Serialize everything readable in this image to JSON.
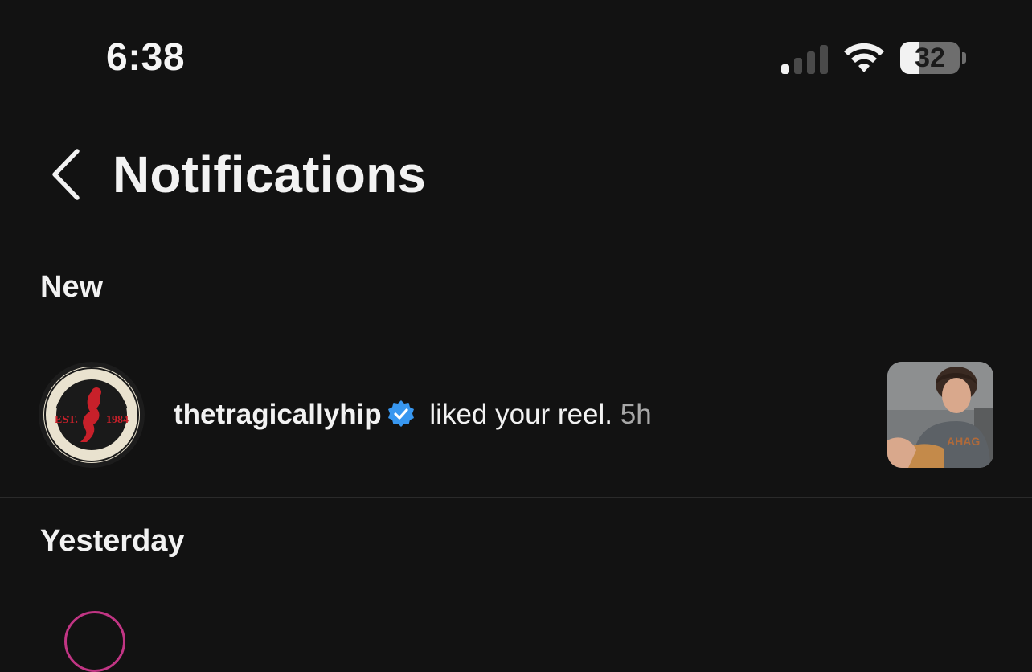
{
  "status_bar": {
    "time": "6:38",
    "battery_percent": "32",
    "battery_level": 0.32,
    "signal_bars_active": 1,
    "signal_bars_total": 4,
    "wifi_icon": "wifi-icon",
    "signal_icon": "cellular-signal-icon"
  },
  "header": {
    "back_icon": "chevron-left-icon",
    "title": "Notifications"
  },
  "sections": {
    "new_label": "New",
    "yesterday_label": "Yesterday"
  },
  "notifications": [
    {
      "username": "thetragicallyhip",
      "verified": true,
      "action": " liked your reel.",
      "time": "5h",
      "avatar_icon": "band-logo-avatar",
      "thumbnail": "reel-thumbnail"
    }
  ],
  "colors": {
    "background": "#121212",
    "text_primary": "#f2f2f2",
    "text_secondary": "#a8a8a8",
    "verified_blue": "#3897f0",
    "divider": "#2a2a2a"
  }
}
